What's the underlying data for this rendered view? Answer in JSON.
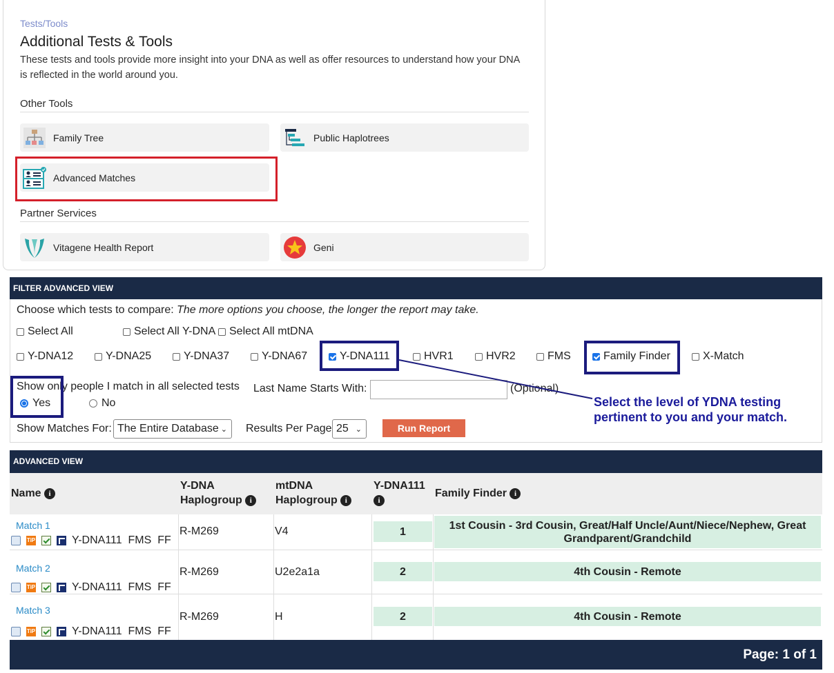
{
  "tools_card": {
    "breadcrumb": "Tests/Tools",
    "title": "Additional Tests & Tools",
    "description": "These tests and tools provide more insight into your DNA as well as offer resources to understand how your DNA is reflected in the world around you.",
    "other_tools_heading": "Other Tools",
    "other_tools": [
      {
        "label": "Family Tree",
        "icon": "family-tree-icon"
      },
      {
        "label": "Public Haplotrees",
        "icon": "haplotree-icon"
      },
      {
        "label": "Advanced Matches",
        "icon": "advanced-matches-icon"
      }
    ],
    "partner_heading": "Partner Services",
    "partners": [
      {
        "label": "Vitagene Health Report",
        "icon": "vitagene-icon"
      },
      {
        "label": "Geni",
        "icon": "geni-star-icon"
      }
    ]
  },
  "filter": {
    "header": "FILTER ADVANCED VIEW",
    "prompt": "Choose which tests to compare:",
    "prompt_note": "The more options you choose, the longer the report may take.",
    "select_all": [
      {
        "label": "Select All",
        "checked": false
      },
      {
        "label": "Select All Y-DNA",
        "checked": false
      },
      {
        "label": "Select All mtDNA",
        "checked": false
      }
    ],
    "tests": [
      {
        "label": "Y-DNA12",
        "checked": false
      },
      {
        "label": "Y-DNA25",
        "checked": false
      },
      {
        "label": "Y-DNA37",
        "checked": false
      },
      {
        "label": "Y-DNA67",
        "checked": false
      },
      {
        "label": "Y-DNA111",
        "checked": true
      },
      {
        "label": "HVR1",
        "checked": false
      },
      {
        "label": "HVR2",
        "checked": false
      },
      {
        "label": "FMS",
        "checked": false
      },
      {
        "label": "Family Finder",
        "checked": true
      },
      {
        "label": "X-Match",
        "checked": false
      }
    ],
    "show_only_label": "Show only people I match in all selected tests",
    "radio_yes": "Yes",
    "radio_no": "No",
    "last_name_label": "Last Name Starts With:",
    "last_name_value": "",
    "optional_label": "(Optional)",
    "show_matches_label": "Show Matches For:",
    "show_matches_value": "The Entire Database",
    "per_page_label": "Results Per Page",
    "per_page_value": "25",
    "run_button": "Run Report"
  },
  "callout": {
    "line1": "Select the level of YDNA testing",
    "line2": "pertinent to you and your match."
  },
  "results": {
    "header": "ADVANCED VIEW",
    "columns": {
      "name": "Name",
      "ydna_hap_1": "Y-DNA",
      "ydna_hap_2": "Haplogroup",
      "mt_hap_1": "mtDNA",
      "mt_hap_2": "Haplogroup",
      "ydna111": "Y-DNA111",
      "family_finder": "Family Finder"
    },
    "rows": [
      {
        "name": "Match 1",
        "tests": "Y-DNA111  FMS  FF",
        "ydna": "R-M269",
        "mtdna": "V4",
        "ydna111": "1",
        "ff": "1st Cousin - 3rd Cousin, Great/Half Uncle/Aunt/Niece/Nephew, Great Grandparent/Grandchild"
      },
      {
        "name": "Match 2",
        "tests": "Y-DNA111  FMS  FF",
        "ydna": "R-M269",
        "mtdna": "U2e2a1a",
        "ydna111": "2",
        "ff": "4th Cousin - Remote"
      },
      {
        "name": "Match 3",
        "tests": "Y-DNA111  FMS  FF",
        "ydna": "R-M269",
        "mtdna": "H",
        "ydna111": "2",
        "ff": "4th Cousin - Remote"
      }
    ],
    "pagination": "Page: 1 of 1"
  }
}
